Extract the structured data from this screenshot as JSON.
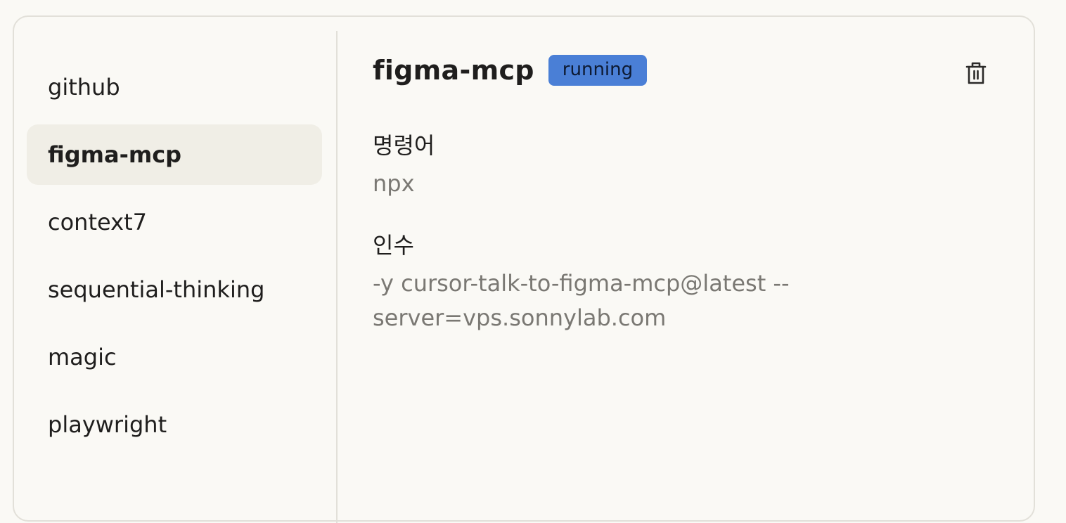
{
  "servers": [
    {
      "label": "github"
    },
    {
      "label": "figma-mcp"
    },
    {
      "label": "context7"
    },
    {
      "label": "sequential-thinking"
    },
    {
      "label": "magic"
    },
    {
      "label": "playwright"
    }
  ],
  "selected_index": 1,
  "detail": {
    "name": "figma-mcp",
    "status": "running",
    "status_color": "#4a7fd6",
    "delete_icon": "trash-icon",
    "command_label": "명령어",
    "command_value": "npx",
    "args_label": "인수",
    "args_line1": "-y cursor-talk-to-figma-mcp@latest --",
    "args_line2": "server=vps.sonnylab.com"
  }
}
